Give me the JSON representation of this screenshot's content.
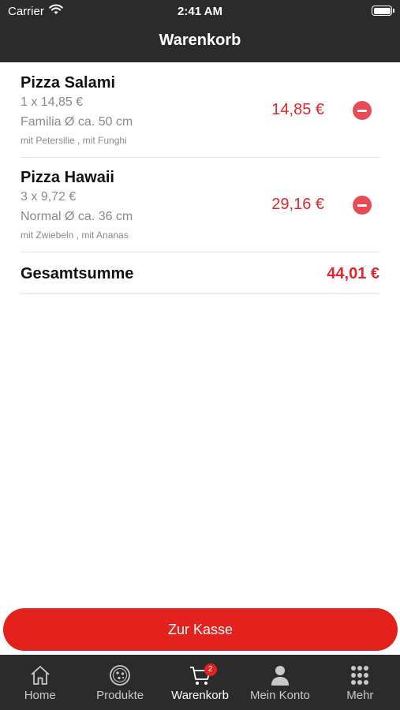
{
  "status_bar": {
    "carrier": "Carrier",
    "time": "2:41 AM"
  },
  "nav": {
    "title": "Warenkorb"
  },
  "cart": {
    "items": [
      {
        "name": "Pizza Salami",
        "quantity_price": "1 x 14,85 €",
        "size": "Familia Ø ca. 50 cm",
        "extras": "mit Petersilie , mit Funghi",
        "price": "14,85 €"
      },
      {
        "name": "Pizza Hawaii",
        "quantity_price": "3 x 9,72 €",
        "size": "Normal Ø ca. 36 cm",
        "extras": "mit Zwiebeln , mit Ananas",
        "price": "29,16 €"
      }
    ],
    "total_label": "Gesamtsumme",
    "total_value": "44,01 €"
  },
  "checkout": {
    "label": "Zur Kasse"
  },
  "tabbar": {
    "tabs": [
      {
        "label": "Home",
        "icon": "home-icon"
      },
      {
        "label": "Produkte",
        "icon": "pizza-icon"
      },
      {
        "label": "Warenkorb",
        "icon": "cart-icon",
        "badge": "2",
        "active": true
      },
      {
        "label": "Mein Konto",
        "icon": "person-icon"
      },
      {
        "label": "Mehr",
        "icon": "grid-icon"
      }
    ]
  },
  "colors": {
    "accent": "#e3211d",
    "price": "#e0272b",
    "bar": "#2b2b2b",
    "remove": "#e94a55"
  }
}
